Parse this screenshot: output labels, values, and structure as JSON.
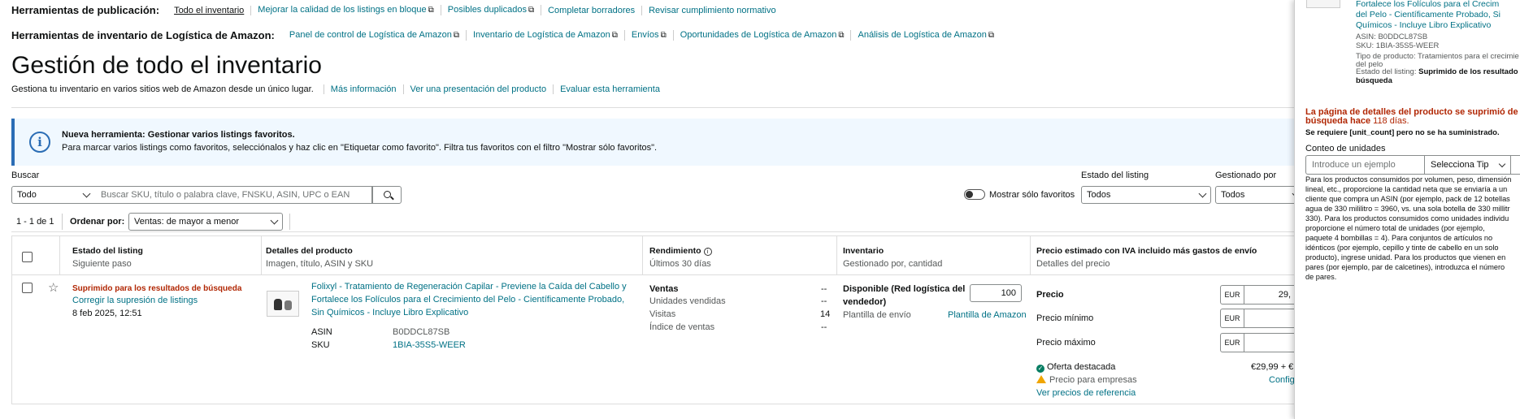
{
  "publication_tools": {
    "label": "Herramientas de publicación:",
    "items": [
      "Todo el inventario",
      "Mejorar la calidad de los listings en bloque",
      "Posibles duplicados",
      "Completar borradores",
      "Revisar cumplimiento normativo"
    ]
  },
  "fba_tools": {
    "label": "Herramientas de inventario de Logística de Amazon:",
    "items": [
      "Panel de control de Logística de Amazon",
      "Inventario de Logística de Amazon",
      "Envíos",
      "Oportunidades de Logística de Amazon",
      "Análisis de Logística de Amazon"
    ]
  },
  "page": {
    "title": "Gestión de todo el inventario",
    "subtitle": "Gestiona tu inventario en varios sitios web de Amazon desde un único lugar.",
    "links": [
      "Más información",
      "Ver una presentación del producto",
      "Evaluar esta herramienta"
    ]
  },
  "banner": {
    "title": "Nueva herramienta: Gestionar varios listings favoritos.",
    "text": "Para marcar varios listings como favoritos, selecciónalos y haz clic en \"Etiquetar como favorito\". Filtra tus favoritos con el filtro \"Mostrar sólo favoritos\"."
  },
  "search": {
    "label": "Buscar",
    "scope": "Todo",
    "placeholder": "Buscar SKU, título o palabra clave, FNSKU, ASIN, UPC o EAN"
  },
  "filters": {
    "favorites_label": "Mostrar sólo favoritos",
    "listing_status_label": "Estado del listing",
    "listing_status_value": "Todos",
    "managed_by_label": "Gestionado por",
    "managed_by_value": "Todos"
  },
  "pagination": {
    "range": "1 - 1 de 1",
    "sort_label": "Ordenar por:",
    "sort_value": "Ventas: de mayor a menor"
  },
  "columns": [
    {
      "title": "Estado del listing",
      "sub": "Siguiente paso"
    },
    {
      "title": "Detalles del producto",
      "sub": "Imagen, título, ASIN y SKU"
    },
    {
      "title": "Rendimiento",
      "sub": "Últimos 30 días"
    },
    {
      "title": "Inventario",
      "sub": "Gestionado por, cantidad"
    },
    {
      "title": "Precio estimado con IVA incluido más gastos de envío",
      "sub": "Detalles del precio"
    }
  ],
  "row": {
    "status": "Suprimido para los resultados de búsqueda",
    "next_step": "Corregir la supresión de listings",
    "date": "8 feb 2025, 12:51",
    "title_lines": [
      "Folixyl - Tratamiento de Regeneración Capilar - Previene la Caída del Cabello y",
      "Fortalece los Folículos para el Crecimiento del Pelo - Científicamente Probado,",
      "Sin Químicos - Incluye Libro Explicativo"
    ],
    "asin_label": "ASIN",
    "asin": "B0DDCL87SB",
    "sku_label": "SKU",
    "sku": "1BIA-35S5-WEER",
    "perf": [
      {
        "label": "Ventas",
        "value": "--"
      },
      {
        "label": "Unidades vendidas",
        "value": "--"
      },
      {
        "label": "Visitas",
        "value": "14"
      },
      {
        "label": "Índice de ventas",
        "value": "--"
      }
    ],
    "inventory_available": "Disponible (Red logística del",
    "inventory_available2": "vendedor)",
    "quantity": "100",
    "shipping_template_label": "Plantilla de envío",
    "shipping_template": "Plantilla de Amazon",
    "price_label": "Precio",
    "price_value": "29,",
    "min_price_label": "Precio mínimo",
    "max_price_label": "Precio máximo",
    "currency": "EUR",
    "featured_offer": "Oferta destacada",
    "featured_offer_value": "€29,99 + €",
    "business_price": "Precio para empresas",
    "business_link": "Config",
    "reference_prices": "Ver precios de referencia"
  },
  "panel": {
    "title_lines": [
      "Fortalece los Folículos para el Crecim",
      "del Pelo - Científicamente Probado, Si",
      "Químicos - Incluye Libro Explicativo"
    ],
    "asin": "ASIN: B0DDCL87SB",
    "sku": "SKU: 1BIA-35S5-WEER",
    "product_type": "Tipo de producto: Tratamientos para el crecimie",
    "product_type2": "del pelo",
    "status_label": "Estado del listing:",
    "status_value": "Suprimido de los resultado",
    "status_value2": "búsqueda",
    "alert_line1": "La página de detalles del producto se suprimió de",
    "alert_line2": "búsqueda hace",
    "alert_days": "118 días.",
    "required": "Se requiere [unit_count] pero no se ha suministrado.",
    "unit_count_label": "Conteo de unidades",
    "unit_placeholder": "Introduce un ejemplo",
    "type_placeholder": "Selecciona Tip",
    "help": "Para los productos consumidos por volumen, peso, dimensión lineal, etc., proporcione la cantidad neta que se enviaría a un cliente que compra un ASIN (por ejemplo, pack de 12 botellas agua de 330 mililitro = 3960, vs. una sola botella de 330 millitr 330). Para los productos consumidos como unidades individu proporcione el número total de unidades (por ejemplo, paquete 4 bombillas = 4). Para conjuntos de artículos no idénticos (por ejemplo, cepillo y tinte de cabello en un solo producto), ingrese unidad. Para los productos que vienen en pares (por ejemplo, par de calcetines), introduzca el número de pares."
  },
  "colors": {
    "link": "#007185",
    "alert": "#b12704",
    "banner_bg": "#f0f8ff",
    "banner_accent": "#2b6db5"
  }
}
